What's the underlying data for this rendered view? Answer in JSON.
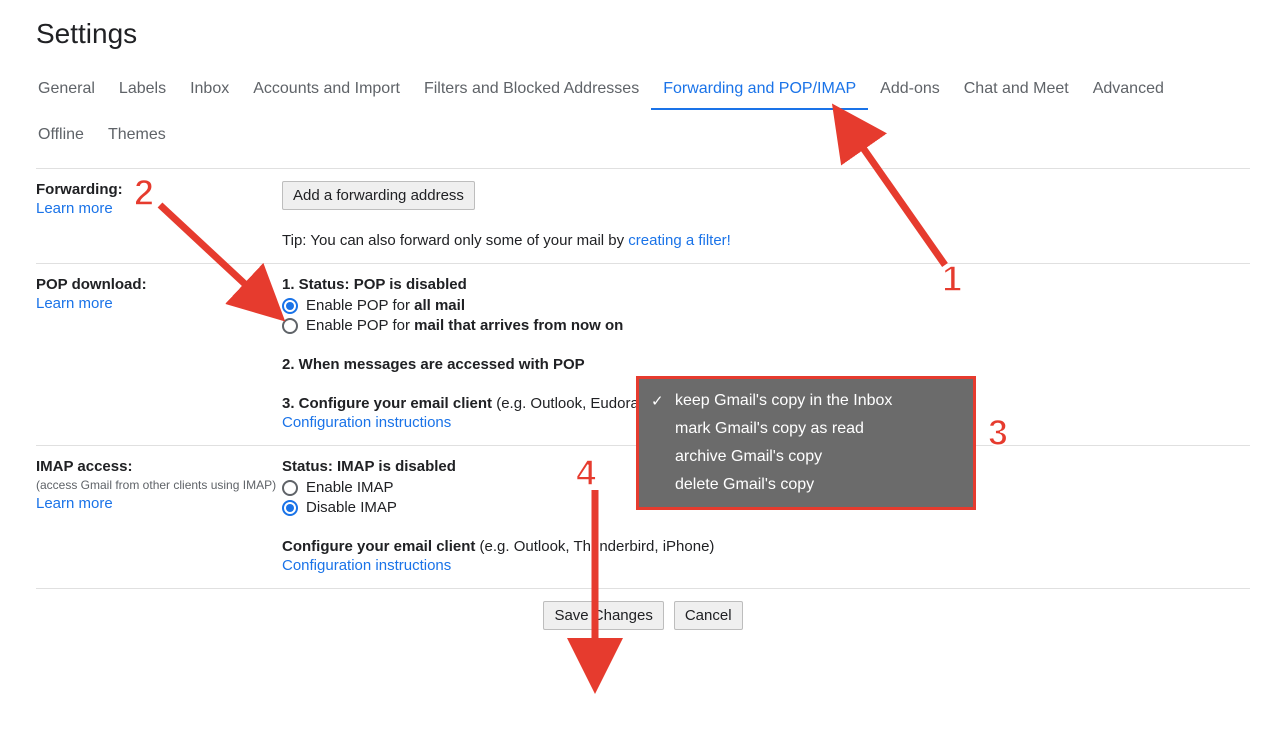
{
  "page_title": "Settings",
  "tabs": {
    "general": "General",
    "labels": "Labels",
    "inbox": "Inbox",
    "accounts": "Accounts and Import",
    "filters": "Filters and Blocked Addresses",
    "forwarding": "Forwarding and POP/IMAP",
    "addons": "Add-ons",
    "chat": "Chat and Meet",
    "advanced": "Advanced",
    "offline": "Offline",
    "themes": "Themes"
  },
  "forwarding": {
    "heading": "Forwarding:",
    "learn_more": "Learn more",
    "add_button": "Add a forwarding address",
    "tip_prefix": "Tip: You can also forward only some of your mail by ",
    "tip_link": "creating a filter!"
  },
  "pop": {
    "heading": "POP download:",
    "learn_more": "Learn more",
    "status_prefix": "1. Status: ",
    "status_value": "POP is disabled",
    "radio1_prefix": "Enable POP for ",
    "radio1_bold": "all mail",
    "radio2_prefix": "Enable POP for ",
    "radio2_bold": "mail that arrives from now on",
    "step2": "2. When messages are accessed with POP",
    "step3_bold": "3. Configure your email client ",
    "step3_rest": "(e.g. Outlook, Eudora, Netscape Mail)",
    "config_link": "Configuration instructions"
  },
  "dropdown": {
    "opt1": "keep Gmail's copy in the Inbox",
    "opt2": "mark Gmail's copy as read",
    "opt3": "archive Gmail's copy",
    "opt4": "delete Gmail's copy"
  },
  "imap": {
    "heading": "IMAP access:",
    "subtext": "(access Gmail from other clients using IMAP)",
    "learn_more": "Learn more",
    "status_prefix": "Status: ",
    "status_value": "IMAP is disabled",
    "radio1": "Enable IMAP",
    "radio2": "Disable IMAP",
    "config_bold": "Configure your email client ",
    "config_rest": "(e.g. Outlook, Thunderbird, iPhone)",
    "config_link": "Configuration instructions"
  },
  "footer": {
    "save": "Save Changes",
    "cancel": "Cancel"
  },
  "annotations": {
    "n1": "1",
    "n2": "2",
    "n3": "3",
    "n4": "4"
  }
}
